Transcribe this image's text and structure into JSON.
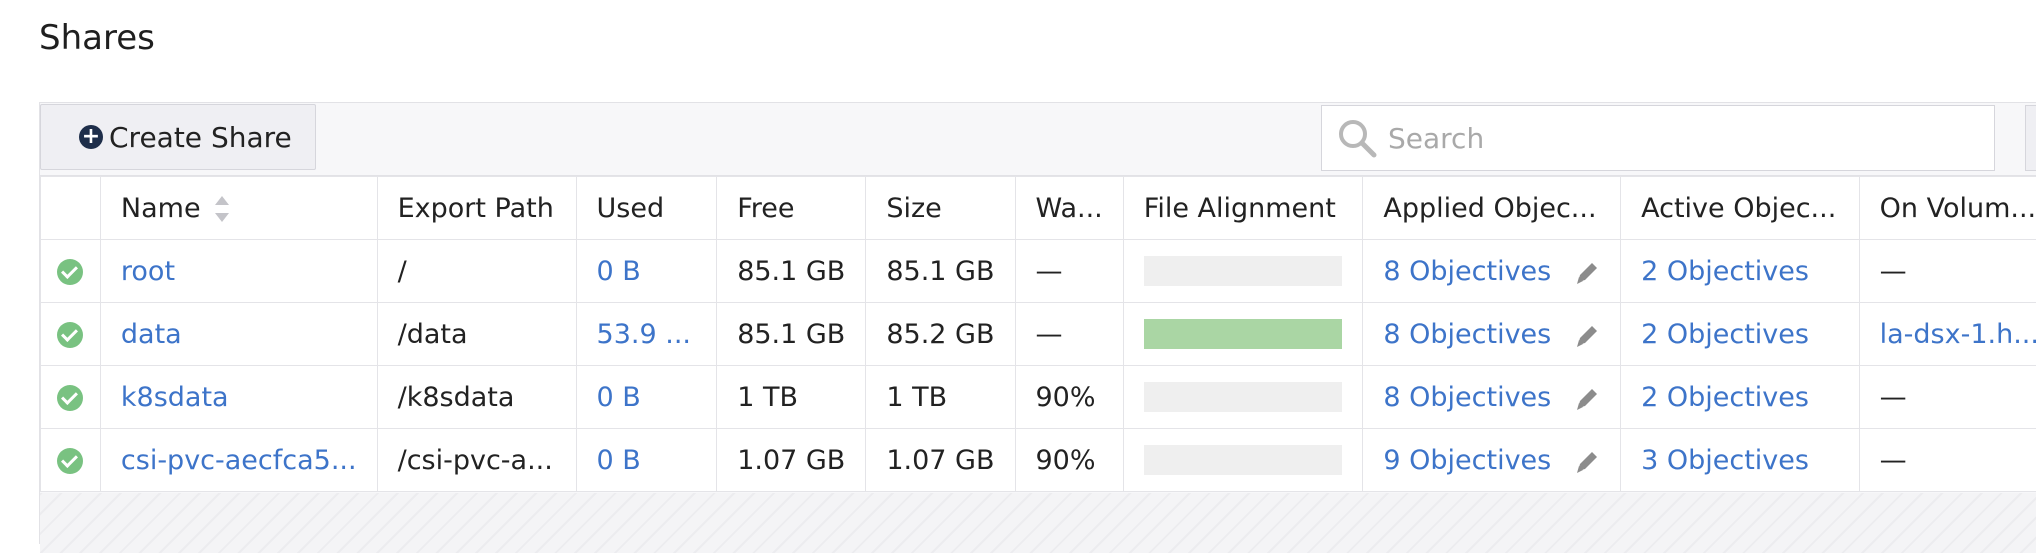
{
  "page": {
    "title": "Shares"
  },
  "toolbar": {
    "create_label": "Create Share",
    "search_placeholder": "Search"
  },
  "table": {
    "columns": [
      "Name",
      "Export Path",
      "Used",
      "Free",
      "Size",
      "Wa...",
      "File Alignment",
      "Applied Objec...",
      "Active Objec...",
      "On Volum..."
    ],
    "rows": [
      {
        "status": "ok",
        "name": "root",
        "path": "/",
        "used": "0 B",
        "free": "85.1 GB",
        "size": "85.1 GB",
        "warn": "—",
        "alignment": 0.0,
        "applied": "8 Objectives",
        "active": "2 Objectives",
        "volume": "—"
      },
      {
        "status": "ok",
        "name": "data",
        "path": "/data",
        "used": "53.9 ...",
        "free": "85.1 GB",
        "size": "85.2 GB",
        "warn": "—",
        "alignment": 1.0,
        "applied": "8 Objectives",
        "active": "2 Objectives",
        "volume": "la-dsx-1.h..."
      },
      {
        "status": "ok",
        "name": "k8sdata",
        "path": "/k8sdata",
        "used": "0 B",
        "free": "1 TB",
        "size": "1 TB",
        "warn": "90%",
        "alignment": 0.0,
        "applied": "8 Objectives",
        "active": "2 Objectives",
        "volume": "—"
      },
      {
        "status": "ok",
        "name": "csi-pvc-aecfca5...",
        "path": "/csi-pvc-a...",
        "used": "0 B",
        "free": "1.07 GB",
        "size": "1.07 GB",
        "warn": "90%",
        "alignment": 0.0,
        "applied": "9 Objectives",
        "active": "3 Objectives",
        "volume": "—"
      }
    ]
  },
  "colors": {
    "link": "#3d74c9",
    "status_ok": "#79c281",
    "alignment_fill": "#aad6a4",
    "alignment_empty": "#efefef"
  },
  "icons": {
    "create": "plus-circle-icon",
    "search": "search-icon",
    "status": "check-circle-icon",
    "sort": "sort-icon",
    "edit": "pencil-icon"
  }
}
